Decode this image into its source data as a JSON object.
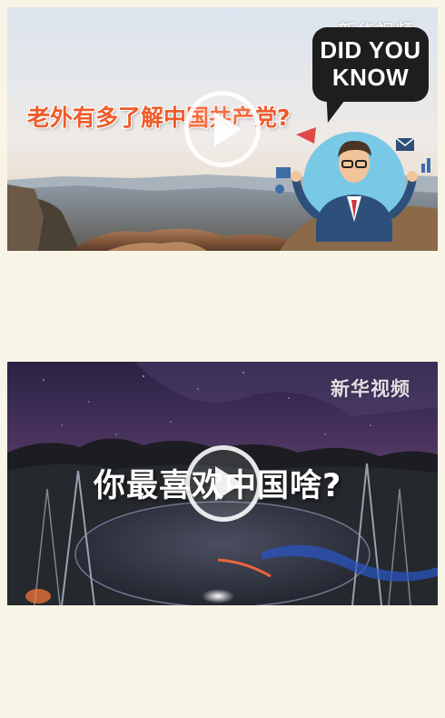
{
  "videos": [
    {
      "watermark": "新华视频",
      "badge_line1": "DID YOU",
      "badge_line2": "KNOW",
      "caption": "老外有多了解中国共产党?",
      "colors": {
        "caption": "#ef5b2a",
        "badge_bg": "#1e1e1e"
      },
      "play_icon": "play-icon"
    },
    {
      "watermark": "新华视频",
      "caption": "你最喜欢中国啥?",
      "colors": {
        "caption": "#ffffff"
      },
      "play_icon": "play-icon"
    }
  ],
  "page": {
    "background": "#f8f5e7"
  }
}
